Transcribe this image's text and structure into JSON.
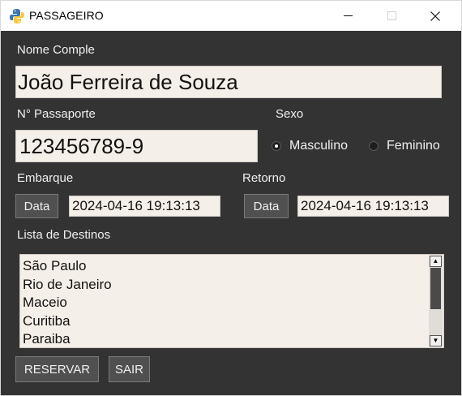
{
  "window": {
    "title": "PASSAGEIRO"
  },
  "form": {
    "nome_label": "Nome Comple",
    "nome_value": "João Ferreira de Souza",
    "passaporte_label": "N° Passaporte",
    "passaporte_value": "123456789-9",
    "sexo_label": "Sexo",
    "sexo_options": [
      "Masculino",
      "Feminino"
    ],
    "sexo_selected": "Masculino",
    "embarque_label": "Embarque",
    "embarque_button": "Data",
    "embarque_value": "2024-04-16 19:13:13",
    "retorno_label": "Retorno",
    "retorno_button": "Data",
    "retorno_value": "2024-04-16 19:13:13",
    "destinos_label": "Lista de Destinos",
    "destinos": [
      "São Paulo",
      "Rio de Janeiro",
      "Maceio",
      "Curitiba",
      "Paraiba"
    ]
  },
  "actions": {
    "reservar": "RESERVAR",
    "sair": "SAIR"
  },
  "colors": {
    "background": "#333333",
    "entry": "#f5efe9",
    "button": "#505050",
    "text": "#f0f0f0"
  },
  "icons": {
    "app": "python-logo-icon",
    "minimize": "minimize-icon",
    "maximize": "maximize-icon",
    "close": "close-icon"
  }
}
